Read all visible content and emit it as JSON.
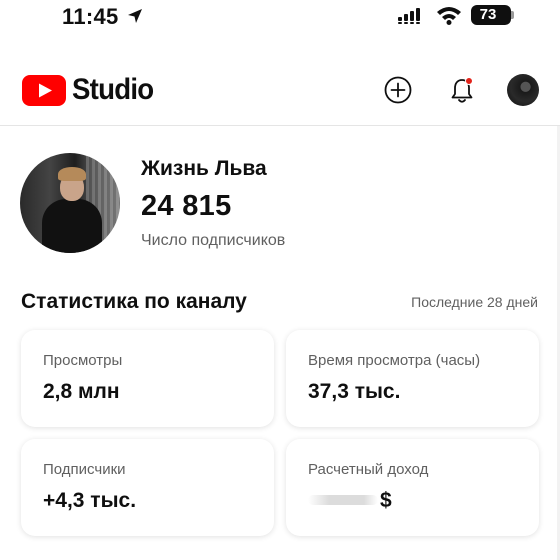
{
  "status_bar": {
    "time": "11:45",
    "battery": "73",
    "icons": [
      "location-arrow-icon",
      "signal-icon",
      "wifi-icon",
      "battery-icon"
    ]
  },
  "header": {
    "logo_text": "Studio",
    "icons": [
      "youtube-logo-icon",
      "create-plus-icon",
      "notification-bell-icon",
      "account-avatar"
    ],
    "colors": {
      "brand_red": "#ff0000",
      "notification_dot": "#e2231a"
    }
  },
  "channel": {
    "name": "Жизнь Льва",
    "subscribers": "24 815",
    "subscribers_label": "Число подписчиков"
  },
  "stats": {
    "title": "Статистика по каналу",
    "period": "Последние 28 дней",
    "cards": [
      {
        "label": "Просмотры",
        "value": "2,8 млн"
      },
      {
        "label": "Время просмотра (часы)",
        "value": "37,3 тыс."
      },
      {
        "label": "Подписчики",
        "value": "+4,3 тыс."
      },
      {
        "label": "Расчетный доход",
        "value": "$"
      }
    ]
  }
}
